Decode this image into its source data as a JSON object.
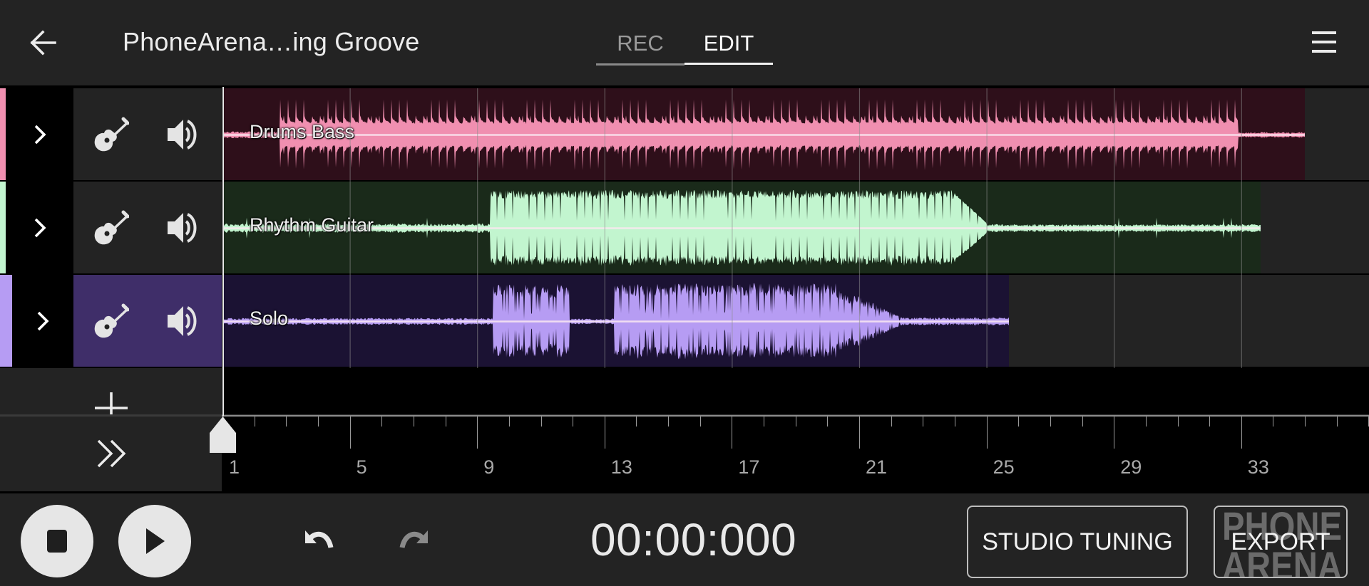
{
  "app": {
    "title": "PhoneArena…ing Groove",
    "tabs": [
      {
        "label": "REC",
        "active": false
      },
      {
        "label": "EDIT",
        "active": true
      }
    ],
    "icons": {
      "back": "arrow-left-icon",
      "menu": "hamburger-menu-icon"
    }
  },
  "timeline": {
    "first_bar": 1,
    "visible_bars": 36,
    "bar_labels": [
      "1",
      "5",
      "9",
      "13",
      "17",
      "21",
      "25",
      "29",
      "33"
    ],
    "label_bars": [
      1,
      5,
      9,
      13,
      17,
      21,
      25,
      29,
      33
    ],
    "playhead_bar": 1
  },
  "tracks": [
    {
      "name": "Drums Bass",
      "color": "#f08fb0",
      "clip_bg": "#2e0f1a",
      "selected": false,
      "instrument_icon": "acoustic-guitar-icon",
      "volume_icon": "speaker-icon",
      "clip_start_bar": 1,
      "clip_end_bar": 35,
      "wave": {
        "style": "drums",
        "segments": [
          {
            "from": 1,
            "to": 2.8,
            "level": 0.06
          },
          {
            "from": 2.8,
            "to": 32.9,
            "level": 0.85,
            "body": 0.25
          },
          {
            "from": 32.9,
            "to": 35,
            "level": 0.05
          }
        ]
      }
    },
    {
      "name": "Rhythm Guitar",
      "color": "#c2f5cf",
      "clip_bg": "#1a2a1a",
      "selected": false,
      "instrument_icon": "acoustic-guitar-icon",
      "volume_icon": "speaker-icon",
      "clip_start_bar": 1,
      "clip_end_bar": 33.6,
      "wave": {
        "style": "guitar",
        "segments": [
          {
            "from": 1,
            "to": 9.4,
            "level": 0.08
          },
          {
            "from": 9.4,
            "to": 24,
            "level": 0.92,
            "body": 0.7
          },
          {
            "from": 24,
            "to": 25,
            "level": 0.85,
            "body": 0.8,
            "decay": true
          },
          {
            "from": 25,
            "to": 33.5,
            "level": 0.07
          }
        ]
      }
    },
    {
      "name": "Solo",
      "color": "#b69cf3",
      "clip_bg": "#1b1233",
      "selected": true,
      "instrument_icon": "acoustic-guitar-icon",
      "volume_icon": "speaker-icon",
      "clip_start_bar": 1,
      "clip_end_bar": 25.7,
      "wave": {
        "style": "solo",
        "segments": [
          {
            "from": 1,
            "to": 9.5,
            "level": 0.06
          },
          {
            "from": 9.5,
            "to": 11.9,
            "level": 0.9,
            "body": 0.55
          },
          {
            "from": 11.9,
            "to": 13.3,
            "level": 0.05
          },
          {
            "from": 13.3,
            "to": 20.3,
            "level": 0.92,
            "body": 0.6
          },
          {
            "from": 20.3,
            "to": 22.3,
            "level": 0.85,
            "body": 0.5,
            "decay": true
          },
          {
            "from": 22.3,
            "to": 25.7,
            "level": 0.07
          }
        ]
      }
    }
  ],
  "add_track": {
    "icon": "plus-icon"
  },
  "expand": {
    "icon": "double-chevron-right-icon"
  },
  "transport": {
    "stop_icon": "stop-icon",
    "play_icon": "play-icon",
    "undo_icon": "undo-icon",
    "redo_icon": "redo-icon",
    "redo_enabled": false,
    "time": "00:00:000"
  },
  "buttons": {
    "studio_tuning": "STUDIO TUNING",
    "export": "EXPORT"
  },
  "watermark": {
    "line1": "PHONE",
    "line2": "ARENA"
  }
}
